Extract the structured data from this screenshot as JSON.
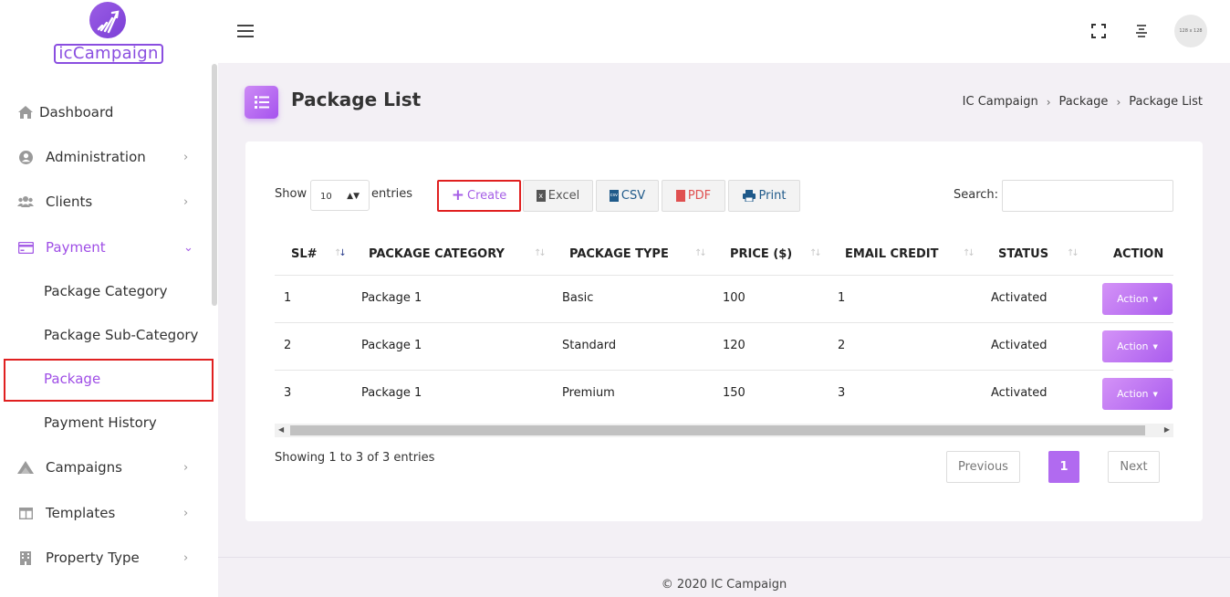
{
  "brand": {
    "logo_text": "icCampaign"
  },
  "sidebar": {
    "items": [
      {
        "label": "Dashboard",
        "icon": "home-icon"
      },
      {
        "label": "Administration",
        "icon": "user-circle-icon"
      },
      {
        "label": "Clients",
        "icon": "users-icon"
      },
      {
        "label": "Payment",
        "icon": "credit-card-icon"
      },
      {
        "label": "Package Category"
      },
      {
        "label": "Package Sub-Category"
      },
      {
        "label": "Package"
      },
      {
        "label": "Payment History"
      },
      {
        "label": "Campaigns",
        "icon": "mountain-icon"
      },
      {
        "label": "Templates",
        "icon": "columns-icon"
      },
      {
        "label": "Property Type",
        "icon": "building-icon"
      }
    ]
  },
  "header": {
    "avatar_text": "128 x 128"
  },
  "page": {
    "title": "Package List",
    "breadcrumb": [
      "IC Campaign",
      "Package",
      "Package List"
    ]
  },
  "toolbar": {
    "show_label": "Show",
    "entries_value": "10",
    "entries_label": "entries",
    "create_label": "Create",
    "excel_label": "Excel",
    "csv_label": "CSV",
    "pdf_label": "PDF",
    "print_label": "Print",
    "search_label": "Search:"
  },
  "table": {
    "columns": [
      "SL#",
      "PACKAGE CATEGORY",
      "PACKAGE TYPE",
      "PRICE ($)",
      "EMAIL CREDIT",
      "STATUS",
      "ACTION"
    ],
    "rows": [
      {
        "sl": "1",
        "category": "Package 1",
        "type": "Basic",
        "price": "100",
        "credit": "1",
        "status": "Activated",
        "action": "Action"
      },
      {
        "sl": "2",
        "category": "Package 1",
        "type": "Standard",
        "price": "120",
        "credit": "2",
        "status": "Activated",
        "action": "Action"
      },
      {
        "sl": "3",
        "category": "Package 1",
        "type": "Premium",
        "price": "150",
        "credit": "3",
        "status": "Activated",
        "action": "Action"
      }
    ]
  },
  "pagination": {
    "info": "Showing 1 to 3 of 3 entries",
    "previous": "Previous",
    "current": "1",
    "next": "Next"
  },
  "footer": {
    "text": "© 2020 IC Campaign"
  },
  "colors": {
    "accent": "#a855f7",
    "highlight": "#e02020"
  }
}
